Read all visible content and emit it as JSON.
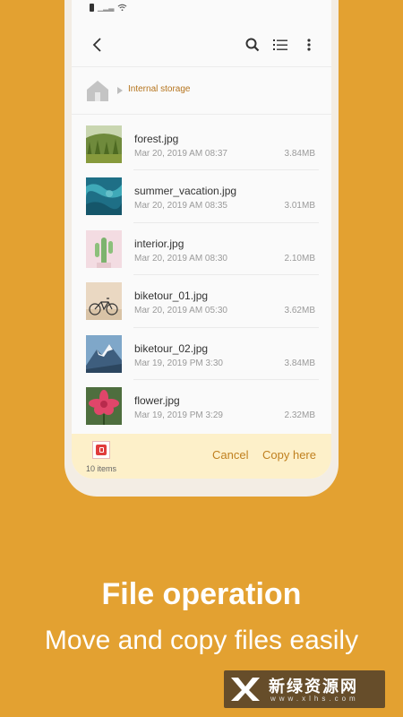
{
  "breadcrumb": {
    "current_folder": "Internal storage"
  },
  "icons": {
    "back": "arrow-left-icon",
    "search": "search-icon",
    "view": "list-view-icon",
    "more": "more-vertical-icon",
    "home": "home-icon"
  },
  "files": [
    {
      "name": "forest.jpg",
      "date": "Mar 20, 2019 AM 08:37",
      "size": "3.84MB",
      "thumb": "forest-thumbnail"
    },
    {
      "name": "summer_vacation.jpg",
      "date": "Mar 20, 2019 AM 08:35",
      "size": "3.01MB",
      "thumb": "ocean-thumbnail"
    },
    {
      "name": "interior.jpg",
      "date": "Mar 20, 2019 AM 08:30",
      "size": "2.10MB",
      "thumb": "cactus-thumbnail"
    },
    {
      "name": "biketour_01.jpg",
      "date": "Mar 20, 2019 AM 05:30",
      "size": "3.62MB",
      "thumb": "bicycle-thumbnail"
    },
    {
      "name": "biketour_02.jpg",
      "date": "Mar 19, 2019 PM 3:30",
      "size": "3.84MB",
      "thumb": "mountain-thumbnail"
    },
    {
      "name": "flower.jpg",
      "date": "Mar 19, 2019 PM 3:29",
      "size": "2.32MB",
      "thumb": "flower-thumbnail"
    }
  ],
  "bottom_bar": {
    "items_count": "10 items",
    "cancel_label": "Cancel",
    "copy_label": "Copy here"
  },
  "promo": {
    "title": "File operation",
    "subtitle": "Move and copy files easily"
  },
  "watermark": {
    "name": "新绿资源网",
    "url": "www.xlhs.com"
  },
  "colors": {
    "background": "#E3A131",
    "accent": "#C0801F",
    "bottom_bar": "#FDF0C9"
  }
}
